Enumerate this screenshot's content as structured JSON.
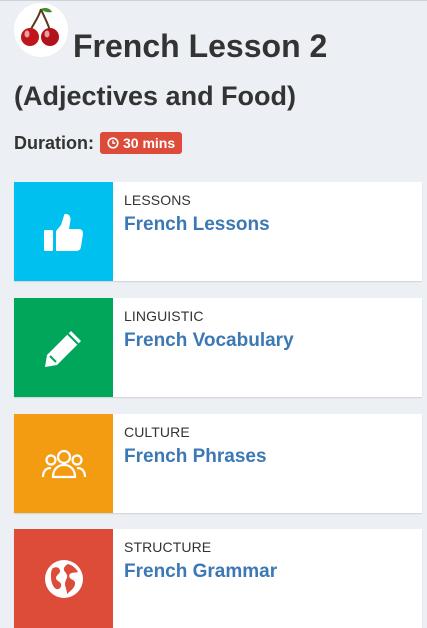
{
  "header": {
    "logo_icon": "cherries-icon",
    "title": "French Lesson 2",
    "subtitle": "(Adjectives and Food)"
  },
  "duration": {
    "label": "Duration:",
    "badge_icon": "clock-icon",
    "value": "30 mins",
    "badge_color": "#dd4b39"
  },
  "cards": [
    {
      "category": "LESSONS",
      "title": "French Lessons",
      "icon": "thumbs-up-icon",
      "color": "#00c0ef"
    },
    {
      "category": "LINGUISTIC",
      "title": "French Vocabulary",
      "icon": "pencil-icon",
      "color": "#00a65a"
    },
    {
      "category": "CULTURE",
      "title": "French Phrases",
      "icon": "users-icon",
      "color": "#f39c12"
    },
    {
      "category": "STRUCTURE",
      "title": "French Grammar",
      "icon": "globe-icon",
      "color": "#dd4b39"
    }
  ],
  "colors": {
    "link": "#3c78b4",
    "background": "#ecf0f5"
  }
}
